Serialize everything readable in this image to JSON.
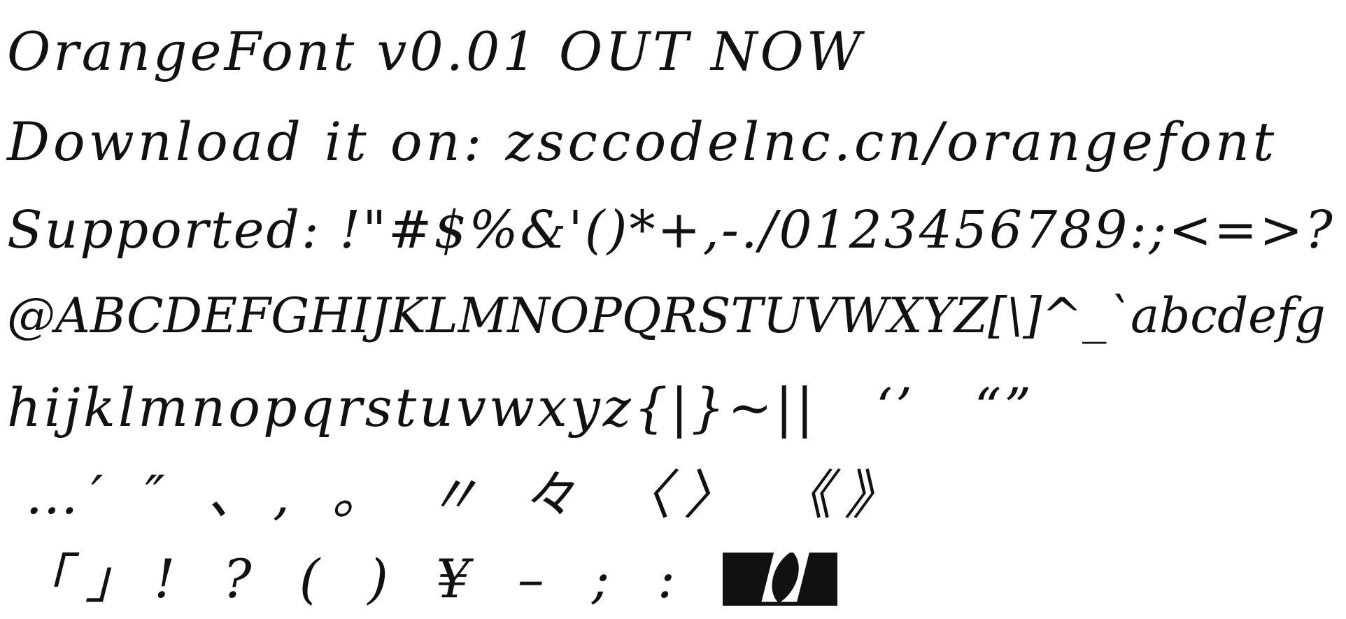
{
  "lines": [
    "OrangeFont v0.01 OUT NOW",
    "Download it on: zsccodelnc.cn/orangefont",
    "Supported: !\"#$%&'()*+,-./0123456789:;<=>?",
    "@ABCDEFGHIJKLMNOPQRSTUVWXYZ[\\]^_`abcdefg",
    "hijklmnopqrstuvwxyz{|}~||   ‘’   “”",
    "…′ ″ 、, 。 〃 々 〈〉 《》",
    "「」! ? ( ) ¥ – ; :"
  ],
  "last_glyph": "【】"
}
